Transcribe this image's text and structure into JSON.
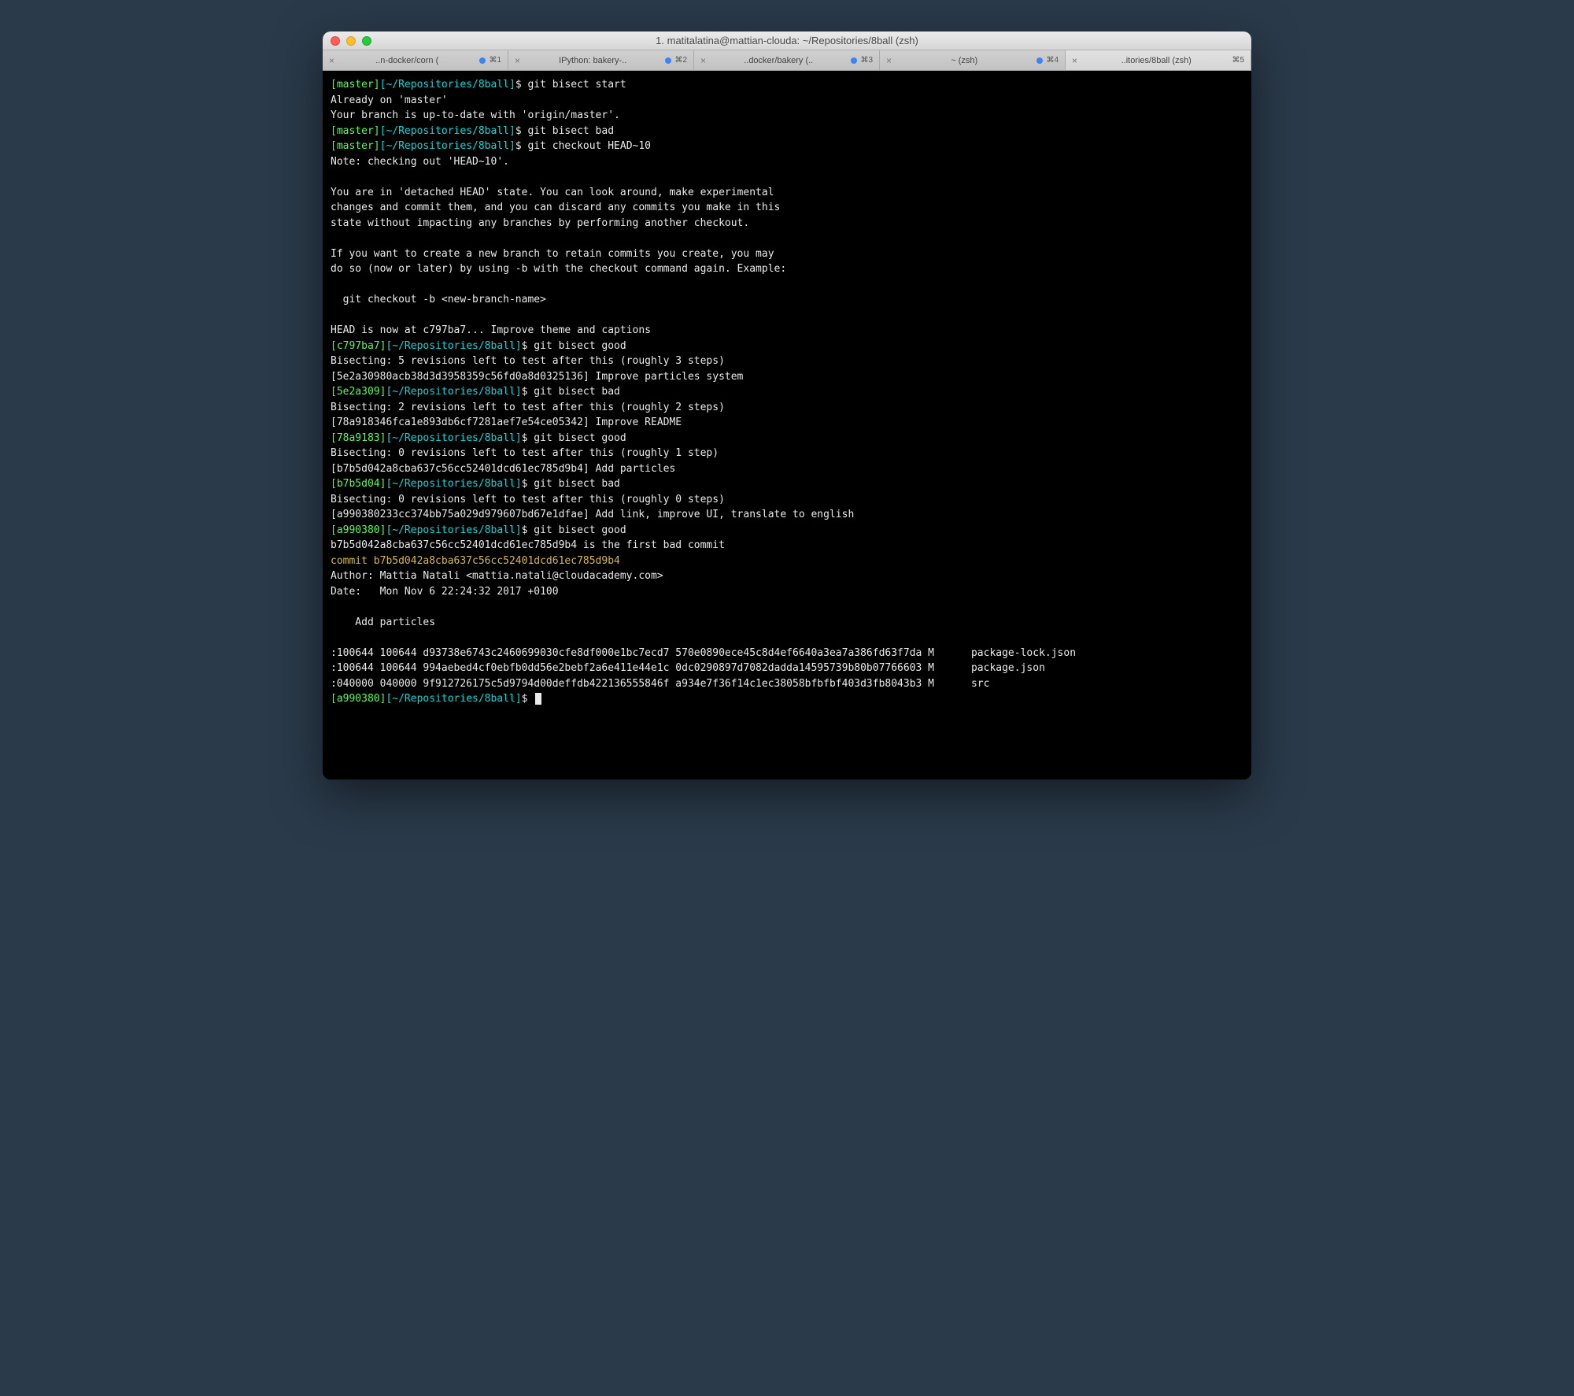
{
  "window": {
    "title": "1. matitalatina@mattian-clouda: ~/Repositories/8ball (zsh)"
  },
  "tabs": [
    {
      "label": "..n-docker/corn (",
      "shortcut": "⌘1",
      "dot": true
    },
    {
      "label": "IPython: bakery-..",
      "shortcut": "⌘2",
      "dot": true
    },
    {
      "label": "..docker/bakery (..",
      "shortcut": "⌘3",
      "dot": true
    },
    {
      "label": "~ (zsh)",
      "shortcut": "⌘4",
      "dot": true
    },
    {
      "label": "..itories/8ball (zsh)",
      "shortcut": "⌘5",
      "dot": false,
      "active": true
    }
  ],
  "lines": [
    {
      "t": "prompt",
      "branch": "[master]",
      "path": "[~/Repositories/8ball]",
      "cmd": "git bisect start"
    },
    {
      "t": "out",
      "text": "Already on 'master'"
    },
    {
      "t": "out",
      "text": "Your branch is up-to-date with 'origin/master'."
    },
    {
      "t": "prompt",
      "branch": "[master]",
      "path": "[~/Repositories/8ball]",
      "cmd": "git bisect bad"
    },
    {
      "t": "prompt",
      "branch": "[master]",
      "path": "[~/Repositories/8ball]",
      "cmd": "git checkout HEAD~10"
    },
    {
      "t": "out",
      "text": "Note: checking out 'HEAD~10'."
    },
    {
      "t": "out",
      "text": ""
    },
    {
      "t": "out",
      "text": "You are in 'detached HEAD' state. You can look around, make experimental"
    },
    {
      "t": "out",
      "text": "changes and commit them, and you can discard any commits you make in this"
    },
    {
      "t": "out",
      "text": "state without impacting any branches by performing another checkout."
    },
    {
      "t": "out",
      "text": ""
    },
    {
      "t": "out",
      "text": "If you want to create a new branch to retain commits you create, you may"
    },
    {
      "t": "out",
      "text": "do so (now or later) by using -b with the checkout command again. Example:"
    },
    {
      "t": "out",
      "text": ""
    },
    {
      "t": "out",
      "text": "  git checkout -b <new-branch-name>"
    },
    {
      "t": "out",
      "text": ""
    },
    {
      "t": "out",
      "text": "HEAD is now at c797ba7... Improve theme and captions"
    },
    {
      "t": "prompt",
      "branch": "[c797ba7]",
      "path": "[~/Repositories/8ball]",
      "cmd": "git bisect good"
    },
    {
      "t": "out",
      "text": "Bisecting: 5 revisions left to test after this (roughly 3 steps)"
    },
    {
      "t": "out",
      "text": "[5e2a30980acb38d3d3958359c56fd0a8d0325136] Improve particles system"
    },
    {
      "t": "prompt",
      "branch": "[5e2a309]",
      "path": "[~/Repositories/8ball]",
      "cmd": "git bisect bad"
    },
    {
      "t": "out",
      "text": "Bisecting: 2 revisions left to test after this (roughly 2 steps)"
    },
    {
      "t": "out",
      "text": "[78a918346fca1e893db6cf7281aef7e54ce05342] Improve README"
    },
    {
      "t": "prompt",
      "branch": "[78a9183]",
      "path": "[~/Repositories/8ball]",
      "cmd": "git bisect good"
    },
    {
      "t": "out",
      "text": "Bisecting: 0 revisions left to test after this (roughly 1 step)"
    },
    {
      "t": "out",
      "text": "[b7b5d042a8cba637c56cc52401dcd61ec785d9b4] Add particles"
    },
    {
      "t": "prompt",
      "branch": "[b7b5d04]",
      "path": "[~/Repositories/8ball]",
      "cmd": "git bisect bad"
    },
    {
      "t": "out",
      "text": "Bisecting: 0 revisions left to test after this (roughly 0 steps)"
    },
    {
      "t": "out",
      "text": "[a990380233cc374bb75a029d979607bd67e1dfae] Add link, improve UI, translate to english"
    },
    {
      "t": "prompt",
      "branch": "[a990380]",
      "path": "[~/Repositories/8ball]",
      "cmd": "git bisect good"
    },
    {
      "t": "out",
      "text": "b7b5d042a8cba637c56cc52401dcd61ec785d9b4 is the first bad commit"
    },
    {
      "t": "commit",
      "text": "commit b7b5d042a8cba637c56cc52401dcd61ec785d9b4"
    },
    {
      "t": "out",
      "text": "Author: Mattia Natali <mattia.natali@cloudacademy.com>"
    },
    {
      "t": "out",
      "text": "Date:   Mon Nov 6 22:24:32 2017 +0100"
    },
    {
      "t": "out",
      "text": ""
    },
    {
      "t": "out",
      "text": "    Add particles"
    },
    {
      "t": "out",
      "text": ""
    },
    {
      "t": "out",
      "text": ":100644 100644 d93738e6743c2460699030cfe8df000e1bc7ecd7 570e0890ece45c8d4ef6640a3ea7a386fd63f7da M      package-lock.json"
    },
    {
      "t": "out",
      "text": ":100644 100644 994aebed4cf0ebfb0dd56e2bebf2a6e411e44e1c 0dc0290897d7082dadda14595739b80b07766603 M      package.json"
    },
    {
      "t": "out",
      "text": ":040000 040000 9f912726175c5d9794d00deffdb422136555846f a934e7f36f14c1ec38058bfbfbf403d3fb8043b3 M      src"
    },
    {
      "t": "prompt",
      "branch": "[a990380]",
      "path": "[~/Repositories/8ball]",
      "cmd": "",
      "cursor": true
    }
  ],
  "dollar": "$"
}
